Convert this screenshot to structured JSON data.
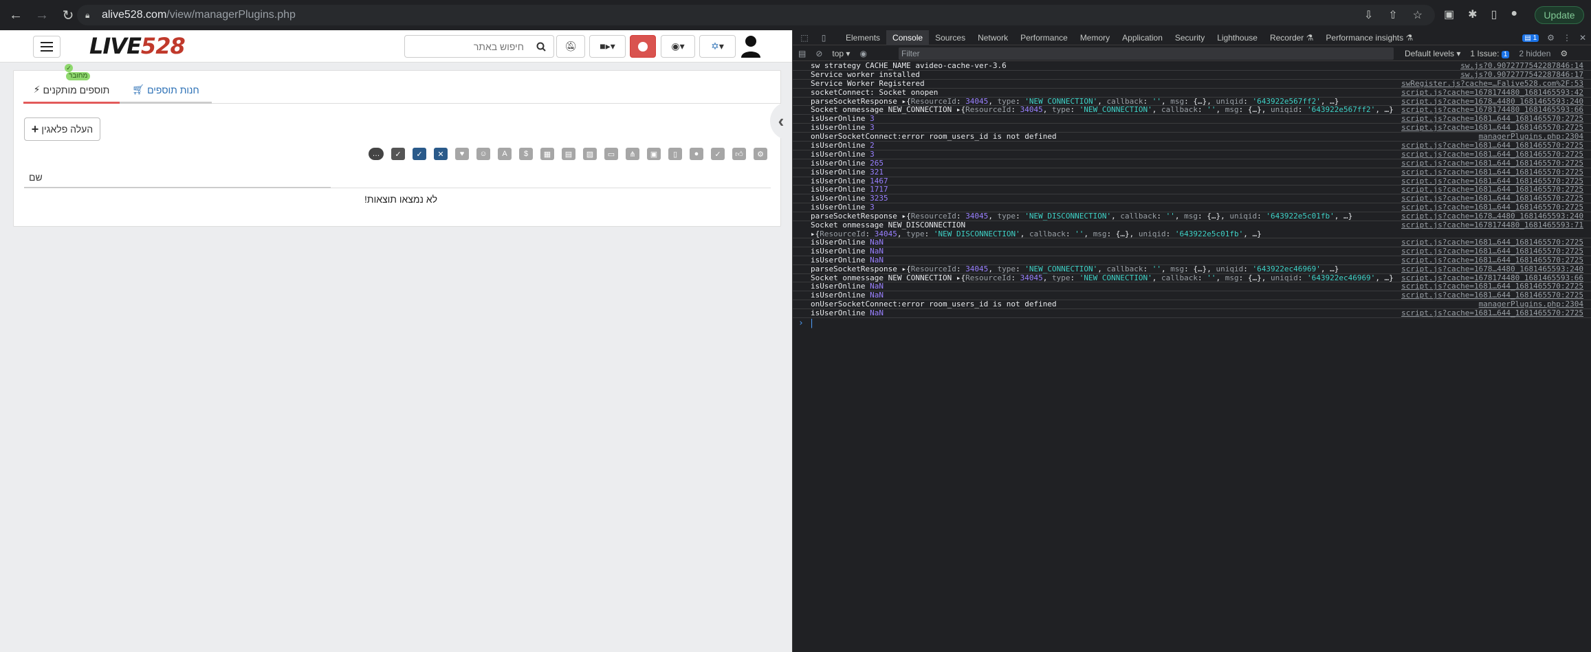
{
  "browser": {
    "url_host": "alive528.com",
    "url_path": "/view/managerPlugins.php",
    "update_label": "Update"
  },
  "site": {
    "logo_text": "LIVE",
    "logo_num": "528",
    "search_placeholder": "חיפוש באתר",
    "tabs": [
      {
        "label": "תוספים מותקנים",
        "badge": "מחובר"
      },
      {
        "label": "חנות תוספים"
      }
    ],
    "upload_label": "העלה פלאגין",
    "column_name": "שם",
    "no_results": "לא נמצאו תוצאות!"
  },
  "devtools": {
    "tabs": [
      "Elements",
      "Console",
      "Sources",
      "Network",
      "Performance",
      "Memory",
      "Application",
      "Security",
      "Lighthouse",
      "Recorder ⚗",
      "Performance insights ⚗"
    ],
    "msg_badge": "1",
    "context": "top",
    "filter_placeholder": "Filter",
    "levels": "Default levels",
    "issues": "1 Issue:",
    "issues_count": "1",
    "hidden": "2 hidden"
  },
  "console_rows": [
    {
      "text": "sw strategy CACHE_NAME avideo-cache-ver-3.6",
      "src": "sw.js?0.9072777542287846:14"
    },
    {
      "text": "Service worker installed",
      "src": "sw.js?0.9072777542287846:17"
    },
    {
      "text": "Service Worker Registered",
      "src": "swRegister.js?cache=…Falive528.com%2F:53"
    },
    {
      "text": "socketConnect: Socket onopen",
      "src": "script.js?cache=1678174480_1681465593:42"
    },
    {
      "text": "parseSocketResponse ▸{ResourceId: 34045, type: 'NEW_CONNECTION', callback: '', msg: {…}, uniqid: '643922e567ff2', …}",
      "src": "script.js?cache=1678…4480_1681465593:240"
    },
    {
      "text": "Socket onmessage NEW_CONNECTION ▸{ResourceId: 34045, type: 'NEW_CONNECTION', callback: '', msg: {…}, uniqid: '643922e567ff2', …}",
      "src": "script.js?cache=1678174480_1681465593:66"
    },
    {
      "text": "isUserOnline 3",
      "src": "script.js?cache=1681…644_1681465570:2725"
    },
    {
      "text": "isUserOnline 3",
      "src": "script.js?cache=1681…644_1681465570:2725"
    },
    {
      "text": "onUserSocketConnect:error room_users_id is not defined",
      "src": "managerPlugins.php:2304"
    },
    {
      "text": "isUserOnline 2",
      "src": "script.js?cache=1681…644_1681465570:2725"
    },
    {
      "text": "isUserOnline 3",
      "src": "script.js?cache=1681…644_1681465570:2725"
    },
    {
      "text": "isUserOnline 265",
      "src": "script.js?cache=1681…644_1681465570:2725"
    },
    {
      "text": "isUserOnline 321",
      "src": "script.js?cache=1681…644_1681465570:2725"
    },
    {
      "text": "isUserOnline 1467",
      "src": "script.js?cache=1681…644_1681465570:2725"
    },
    {
      "text": "isUserOnline 1717",
      "src": "script.js?cache=1681…644_1681465570:2725"
    },
    {
      "text": "isUserOnline 3235",
      "src": "script.js?cache=1681…644_1681465570:2725"
    },
    {
      "text": "isUserOnline 3",
      "src": "script.js?cache=1681…644_1681465570:2725"
    },
    {
      "text": "parseSocketResponse ▸{ResourceId: 34045, type: 'NEW_DISCONNECTION', callback: '', msg: {…}, uniqid: '643922e5c01fb', …}",
      "src": "script.js?cache=1678…4480_1681465593:240"
    },
    {
      "text": "Socket onmessage NEW_DISCONNECTION",
      "text2": "▸{ResourceId: 34045, type: 'NEW_DISCONNECTION', callback: '', msg: {…}, uniqid: '643922e5c01fb', …}",
      "src": "script.js?cache=1678174480_1681465593:71"
    },
    {
      "text": "isUserOnline NaN",
      "src": "script.js?cache=1681…644_1681465570:2725"
    },
    {
      "text": "isUserOnline NaN",
      "src": "script.js?cache=1681…644_1681465570:2725"
    },
    {
      "text": "isUserOnline NaN",
      "src": "script.js?cache=1681…644_1681465570:2725"
    },
    {
      "text": "parseSocketResponse ▸{ResourceId: 34045, type: 'NEW_CONNECTION', callback: '', msg: {…}, uniqid: '643922ec46969', …}",
      "src": "script.js?cache=1678…4480_1681465593:240"
    },
    {
      "text": "Socket onmessage NEW_CONNECTION ▸{ResourceId: 34045, type: 'NEW_CONNECTION', callback: '', msg: {…}, uniqid: '643922ec46969', …}",
      "src": "script.js?cache=1678174480_1681465593:66"
    },
    {
      "text": "isUserOnline NaN",
      "src": "script.js?cache=1681…644_1681465570:2725"
    },
    {
      "text": "isUserOnline NaN",
      "src": "script.js?cache=1681…644_1681465570:2725"
    },
    {
      "text": "onUserSocketConnect:error room_users_id is not defined",
      "src": "managerPlugins.php:2304"
    },
    {
      "text": "isUserOnline NaN",
      "src": "script.js?cache=1681…644_1681465570:2725"
    }
  ]
}
